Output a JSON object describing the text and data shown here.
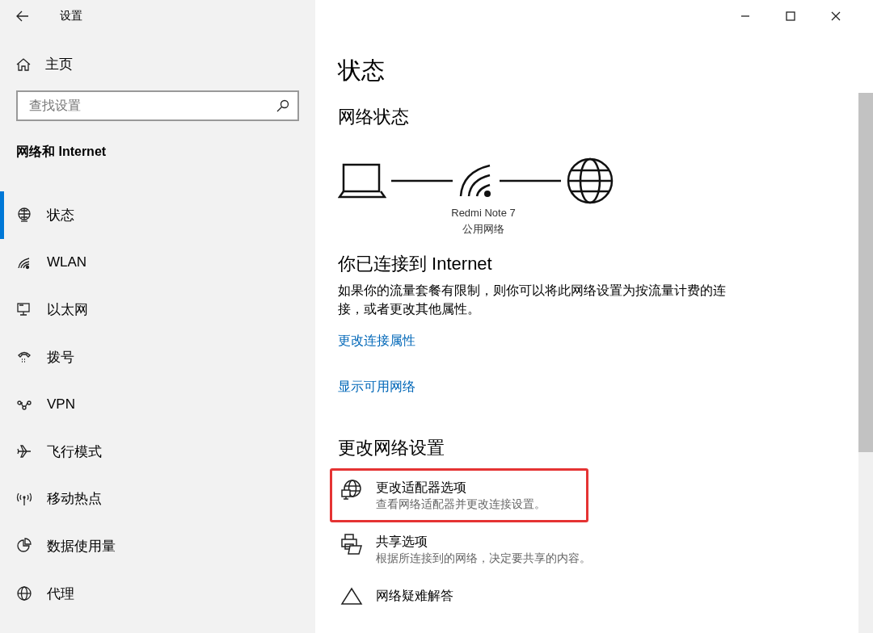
{
  "window": {
    "title": "设置"
  },
  "sidebar": {
    "home": "主页",
    "search": {
      "placeholder": "查找设置"
    },
    "section": "网络和 Internet",
    "items": [
      {
        "label": "状态",
        "selected": true
      },
      {
        "label": "WLAN",
        "selected": false
      },
      {
        "label": "以太网",
        "selected": false
      },
      {
        "label": "拨号",
        "selected": false
      },
      {
        "label": "VPN",
        "selected": false
      },
      {
        "label": "飞行模式",
        "selected": false
      },
      {
        "label": "移动热点",
        "selected": false
      },
      {
        "label": "数据使用量",
        "selected": false
      },
      {
        "label": "代理",
        "selected": false
      }
    ]
  },
  "main": {
    "title": "状态",
    "network_status": {
      "heading": "网络状态",
      "device_name": "Redmi Note 7",
      "network_type": "公用网络"
    },
    "connection": {
      "heading": "你已连接到 Internet",
      "description": "如果你的流量套餐有限制，则你可以将此网络设置为按流量计费的连接，或者更改其他属性。",
      "links": [
        "更改连接属性",
        "显示可用网络"
      ]
    },
    "change_settings": {
      "heading": "更改网络设置",
      "options": [
        {
          "title": "更改适配器选项",
          "description": "查看网络适配器并更改连接设置。",
          "highlighted": true
        },
        {
          "title": "共享选项",
          "description": "根据所连接到的网络，决定要共享的内容。",
          "highlighted": false
        },
        {
          "title": "网络疑难解答",
          "highlighted": false
        }
      ]
    }
  }
}
